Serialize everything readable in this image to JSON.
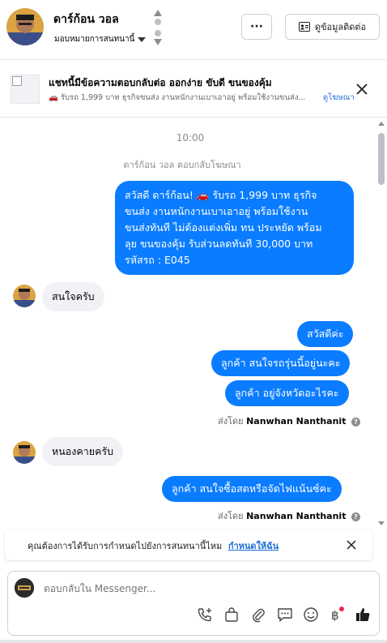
{
  "header": {
    "contact_name": "ดาร์ก้อน วอล",
    "assign_label": "มอบหมายการสนทนานี้",
    "more_label": "···",
    "contact_info_label": "ดูข้อมูลติดต่อ"
  },
  "ad": {
    "title": "แชทนี้มีข้อความตอบกลับต่อ ออกง่าย ขับดี ขนของคุ้ม",
    "subtitle": "🚗 รับรถ 1,999 บาท ธุรกิจขนส่ง งานหนักงานเบาเอาอยู่ พร้อมใช้งานขนส่ง...",
    "link": "ดูโฆษณา"
  },
  "chat": {
    "timestamp": "10:00",
    "replied_note": "ดาร์ก้อน วอล ตอบกลับโฆษณา",
    "outgoing_ad_message_lines": [
      "สวัสดี ดาร์ก้อน! 🚗 รับรถ 1,999 บาท ธุรกิจ",
      "ขนส่ง งานหนักงานเบาเอาอยู่ พร้อมใช้งาน",
      "ขนส่งทันที ไม่ต้องแต่งเพิ่ม ทน ประหยัด พร้อม",
      "ลุย ขนของคุ้ม รับส่วนลดทันที 30,000 บาท",
      "รหัสรถ : E045"
    ],
    "incoming_1": "สนใจครับ",
    "outgoing_1": "สวัสดีค่ะ",
    "outgoing_2": "ลูกค้า สนใจรถรุ่นนี้อยู่นะคะ",
    "outgoing_3": "ลูกค้า อยู่จังหวัดอะไรคะ",
    "sent_by_prefix": "ส่งโดย",
    "sent_by_name": "Nanwhan Nanthanit",
    "incoming_2": "หนองคายครับ",
    "outgoing_4": "ลูกค้า สนใจซื้อสดหรือจัดไฟแน้นซ์คะ"
  },
  "notice": {
    "text": "คุณต้องการได้รับการกำหนดไปยังการสนทนานี้ไหม",
    "link": "กำหนดให้ฉัน"
  },
  "composer": {
    "placeholder": "ตอบกลับใน Messenger..."
  },
  "colors": {
    "accent_blue": "#0a7cff",
    "link_blue": "#1e6fd9",
    "incoming_bubble": "#f0f2f5"
  }
}
